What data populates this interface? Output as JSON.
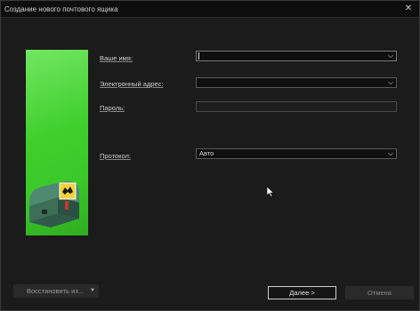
{
  "window": {
    "title": "Создание нового почтового ящика",
    "close_label": "✕"
  },
  "form": {
    "name_label": "Ваше имя:",
    "name_value": "",
    "email_label": "Электронный адрес:",
    "email_value": "",
    "password_label": "Пароль:",
    "password_value": "",
    "protocol_label": "Протокол:",
    "protocol_value": "Авто"
  },
  "buttons": {
    "restore_label": "Восстановить из...",
    "next_label": "Далее  >",
    "cancel_label": "Отмена"
  },
  "icons": {
    "close": "close-icon",
    "dropdown": "chevron-down-icon",
    "mailbox": "mailbox-illustration",
    "cursor": "mouse-pointer-icon"
  },
  "colors": {
    "accent_green": "#3fcf2c",
    "background": "#1b1b1b"
  }
}
